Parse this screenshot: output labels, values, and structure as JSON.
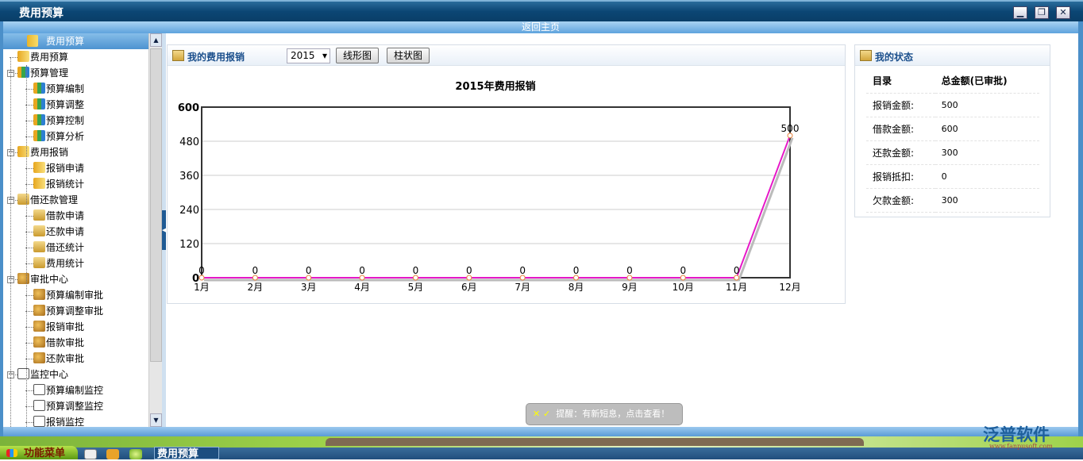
{
  "window": {
    "title": "费用预算",
    "minimize": "▁",
    "restore": "❐",
    "close": "✕"
  },
  "subbar": {
    "home_link": "返回主页"
  },
  "sidebar": {
    "header": "费用预算",
    "items": [
      {
        "label": "费用预算",
        "level": 0,
        "icon": "gold"
      },
      {
        "label": "预算管理",
        "level": 0,
        "icon": "mix",
        "toggle": "−"
      },
      {
        "label": "预算编制",
        "level": 1,
        "icon": "mix"
      },
      {
        "label": "预算调整",
        "level": 1,
        "icon": "mix"
      },
      {
        "label": "预算控制",
        "level": 1,
        "icon": "mix"
      },
      {
        "label": "预算分析",
        "level": 1,
        "icon": "mix"
      },
      {
        "label": "费用报销",
        "level": 0,
        "icon": "gold",
        "toggle": "−"
      },
      {
        "label": "报销申请",
        "level": 1,
        "icon": "gold"
      },
      {
        "label": "报销统计",
        "level": 1,
        "icon": "gold"
      },
      {
        "label": "借还款管理",
        "level": 0,
        "icon": "fold",
        "toggle": "−"
      },
      {
        "label": "借款申请",
        "level": 1,
        "icon": "fold"
      },
      {
        "label": "还款申请",
        "level": 1,
        "icon": "fold"
      },
      {
        "label": "借还统计",
        "level": 1,
        "icon": "fold"
      },
      {
        "label": "费用统计",
        "level": 1,
        "icon": "fold"
      },
      {
        "label": "审批中心",
        "level": 0,
        "icon": "ppl",
        "toggle": "−"
      },
      {
        "label": "预算编制审批",
        "level": 1,
        "icon": "ppl"
      },
      {
        "label": "预算调整审批",
        "level": 1,
        "icon": "ppl"
      },
      {
        "label": "报销审批",
        "level": 1,
        "icon": "ppl"
      },
      {
        "label": "借款审批",
        "level": 1,
        "icon": "ppl"
      },
      {
        "label": "还款审批",
        "level": 1,
        "icon": "ppl"
      },
      {
        "label": "监控中心",
        "level": 0,
        "icon": "doc",
        "toggle": "−"
      },
      {
        "label": "预算编制监控",
        "level": 1,
        "icon": "doc"
      },
      {
        "label": "预算调整监控",
        "level": 1,
        "icon": "doc"
      },
      {
        "label": "报销监控",
        "level": 1,
        "icon": "doc"
      }
    ]
  },
  "expense_panel": {
    "title": "我的费用报销",
    "year": "2015",
    "line_button": "线形图",
    "bar_button": "柱状图"
  },
  "chart_data": {
    "type": "line",
    "title": "2015年费用报销",
    "categories": [
      "1月",
      "2月",
      "3月",
      "4月",
      "5月",
      "6月",
      "7月",
      "8月",
      "9月",
      "10月",
      "11月",
      "12月"
    ],
    "values": [
      0,
      0,
      0,
      0,
      0,
      0,
      0,
      0,
      0,
      0,
      0,
      500
    ],
    "ylim": [
      0,
      600
    ],
    "yticks": [
      "0",
      "120",
      "240",
      "360",
      "480",
      "600"
    ],
    "line_color": "#e619c8",
    "grid": true
  },
  "status_panel": {
    "title": "我的状态",
    "col_item": "目录",
    "col_amount": "总金额(已审批)",
    "rows": [
      {
        "label": "报销金额:",
        "value": "500"
      },
      {
        "label": "借款金额:",
        "value": "600"
      },
      {
        "label": "还款金额:",
        "value": "300"
      },
      {
        "label": "报销抵扣:",
        "value": "0"
      },
      {
        "label": "欠款金额:",
        "value": "300"
      }
    ]
  },
  "toast": {
    "icons": "✕ ✓",
    "text": "提醒：有新短息，点击查看！"
  },
  "taskbar": {
    "start": "功能菜单",
    "active_task": "费用预算"
  },
  "logo": {
    "name": "泛普软件",
    "url": "www.fanpusoft.com"
  }
}
